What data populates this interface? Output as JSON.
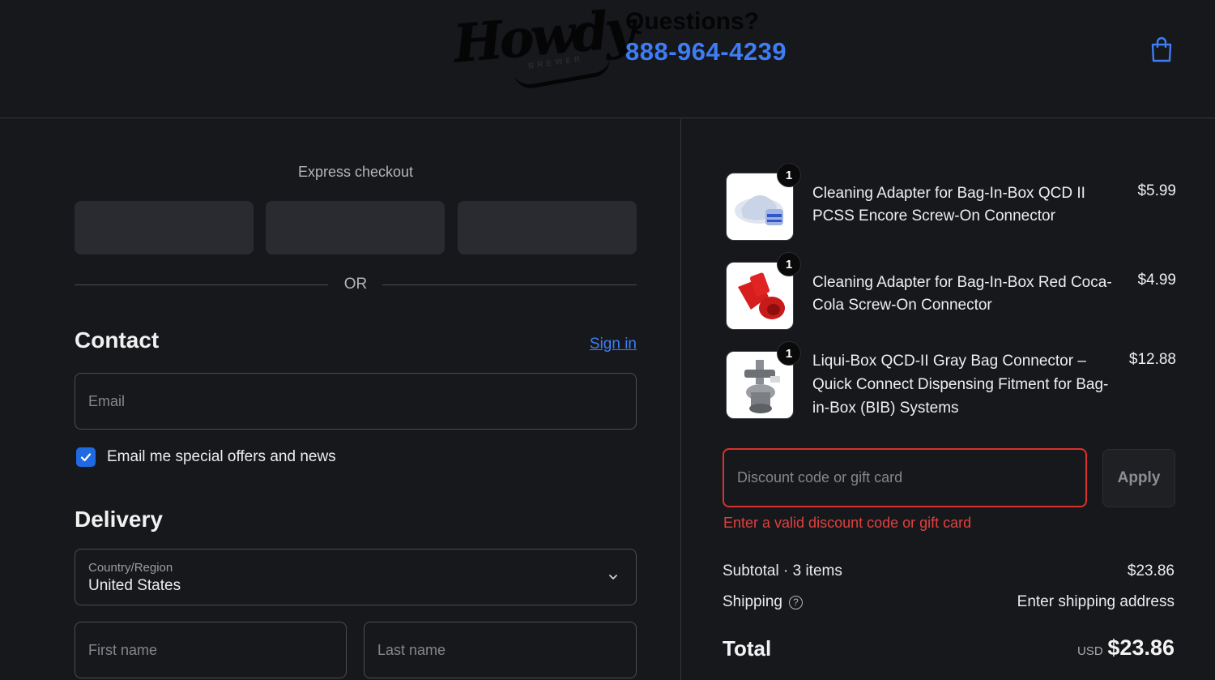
{
  "header": {
    "logo_text": "Howdy",
    "logo_subtext": "BREWER",
    "questions_label": "Questions?",
    "phone": "888-964-4239",
    "cart_icon": "shopping-bag-icon"
  },
  "express": {
    "title": "Express checkout",
    "or_label": "OR"
  },
  "contact": {
    "title": "Contact",
    "sign_in": "Sign in",
    "email_placeholder": "Email",
    "email_value": "",
    "offers_label": "Email me special offers and news",
    "offers_checked": true
  },
  "delivery": {
    "title": "Delivery",
    "country_label": "Country/Region",
    "country_value": "United States",
    "first_name_placeholder": "First name",
    "last_name_placeholder": "Last name"
  },
  "cart": {
    "items": [
      {
        "name": "Cleaning Adapter for Bag-In-Box QCD II PCSS Encore Screw-On Connector",
        "price": "$5.99",
        "qty": "1"
      },
      {
        "name": "Cleaning Adapter for Bag-In-Box Red Coca-Cola Screw-On Connector",
        "price": "$4.99",
        "qty": "1"
      },
      {
        "name": "Liqui-Box QCD-II Gray Bag Connector – Quick Connect Dispensing Fitment for Bag-in-Box (BIB) Systems",
        "price": "$12.88",
        "qty": "1"
      }
    ]
  },
  "discount": {
    "placeholder": "Discount code or gift card",
    "apply_label": "Apply",
    "error": "Enter a valid discount code or gift card"
  },
  "summary": {
    "subtotal_label": "Subtotal · 3 items",
    "subtotal_value": "$23.86",
    "shipping_label": "Shipping",
    "shipping_value": "Enter shipping address",
    "total_label": "Total",
    "currency": "USD",
    "total_value": "$23.86"
  },
  "colors": {
    "accent": "#3d7df5",
    "error": "#e2403d",
    "background": "#17181c"
  }
}
